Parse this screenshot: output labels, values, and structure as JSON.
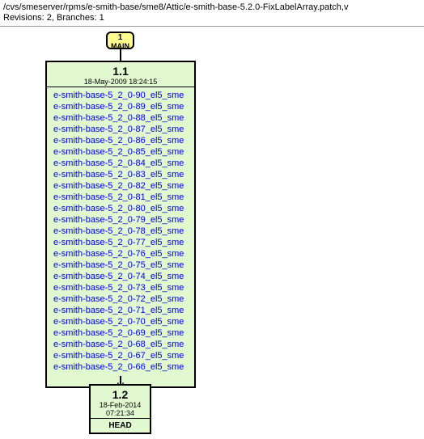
{
  "header": {
    "path": "/cvs/smeserver/rpms/e-smith-base/sme8/Attic/e-smith-base-5.2.0-FixLabelArray.patch,v",
    "revinfo": "Revisions: 2, Branches: 1"
  },
  "branch": {
    "label": "1\nMAIN"
  },
  "rev11": {
    "num": "1.1",
    "date": "18-May-2009 18:24:15",
    "tags": [
      "e-smith-base-5_2_0-90_el5_sme",
      "e-smith-base-5_2_0-89_el5_sme",
      "e-smith-base-5_2_0-88_el5_sme",
      "e-smith-base-5_2_0-87_el5_sme",
      "e-smith-base-5_2_0-86_el5_sme",
      "e-smith-base-5_2_0-85_el5_sme",
      "e-smith-base-5_2_0-84_el5_sme",
      "e-smith-base-5_2_0-83_el5_sme",
      "e-smith-base-5_2_0-82_el5_sme",
      "e-smith-base-5_2_0-81_el5_sme",
      "e-smith-base-5_2_0-80_el5_sme",
      "e-smith-base-5_2_0-79_el5_sme",
      "e-smith-base-5_2_0-78_el5_sme",
      "e-smith-base-5_2_0-77_el5_sme",
      "e-smith-base-5_2_0-76_el5_sme",
      "e-smith-base-5_2_0-75_el5_sme",
      "e-smith-base-5_2_0-74_el5_sme",
      "e-smith-base-5_2_0-73_el5_sme",
      "e-smith-base-5_2_0-72_el5_sme",
      "e-smith-base-5_2_0-71_el5_sme",
      "e-smith-base-5_2_0-70_el5_sme",
      "e-smith-base-5_2_0-69_el5_sme",
      "e-smith-base-5_2_0-68_el5_sme",
      "e-smith-base-5_2_0-67_el5_sme",
      "e-smith-base-5_2_0-66_el5_sme"
    ],
    "ellipsis": "..."
  },
  "rev12": {
    "num": "1.2",
    "date": "18-Feb-2014 07:21:34",
    "head": "HEAD"
  }
}
